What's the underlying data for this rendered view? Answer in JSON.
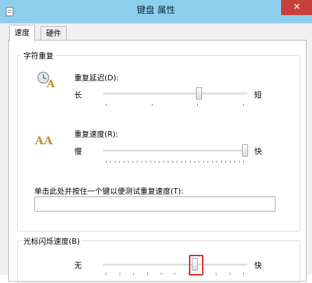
{
  "window": {
    "title": "键盘 属性",
    "close_symbol": "✕"
  },
  "tabs": [
    {
      "label": "速度",
      "active": true
    },
    {
      "label": "硬件",
      "active": false
    }
  ],
  "repeat_group": {
    "title": "字符重复",
    "delay": {
      "label": "重复延迟(D):",
      "min_label": "长",
      "max_label": "短",
      "value_fraction": 0.67,
      "ticks": 4,
      "icon": "clock-a-icon"
    },
    "rate": {
      "label": "重复速度(R):",
      "min_label": "慢",
      "max_label": "快",
      "value_fraction": 1.0,
      "ticks": 32,
      "icon": "double-a-icon"
    },
    "test_label": "单击此处并按住一个键以便测试重复速度(T):",
    "test_value": ""
  },
  "cursor_group": {
    "title": "光标闪烁速度(B)",
    "blink": {
      "min_label": "无",
      "max_label": "快",
      "value_fraction": 0.64,
      "ticks": 11
    }
  },
  "colors": {
    "titlebar": "#8fcfee",
    "close": "#c7403c",
    "highlight": "#e8201a"
  }
}
